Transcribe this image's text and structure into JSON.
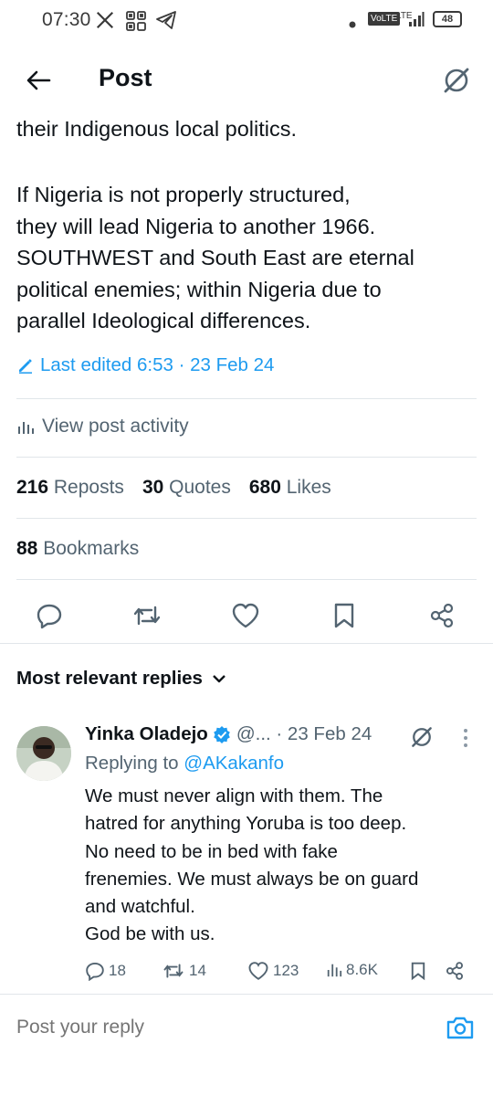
{
  "status_bar": {
    "time": "07:30",
    "volte": "VoLTE",
    "network": "LTE",
    "battery": "48"
  },
  "header": {
    "title": "Post"
  },
  "post": {
    "text_line_1": "their Indigenous local politics.",
    "paragraph_lines": [
      "If Nigeria is not properly structured,",
      "they will lead Nigeria to another 1966.",
      "SOUTHWEST and South East are eternal",
      "political enemies; within Nigeria due to",
      "parallel Ideological differences."
    ],
    "edited_label": "Last edited 6:53 · 23 Feb 24",
    "activity_label": "View post activity",
    "reposts_count": "216",
    "reposts_label": "Reposts",
    "quotes_count": "30",
    "quotes_label": "Quotes",
    "likes_count": "680",
    "likes_label": "Likes",
    "bookmarks_count": "88",
    "bookmarks_label": "Bookmarks"
  },
  "replies_section": {
    "sort_label": "Most relevant replies"
  },
  "reply": {
    "name": "Yinka Oladejo",
    "handle_date": "@... · 23 Feb 24",
    "replying_prefix": "Replying to ",
    "replying_handle": "@AKakanfo",
    "lines": [
      "We must never align with them. The",
      "hatred for anything Yoruba is too deep.",
      "No need to be in bed with fake",
      "frenemies. We must always be on guard",
      "and watchful.",
      "God be with us."
    ],
    "replies": "18",
    "reposts": "14",
    "likes": "123",
    "views": "8.6K"
  },
  "compose": {
    "placeholder": "Post your reply"
  },
  "colors": {
    "accent": "#1d9bf0",
    "text": "#0f1419",
    "muted": "#536471",
    "divider": "#e1e6ea"
  }
}
